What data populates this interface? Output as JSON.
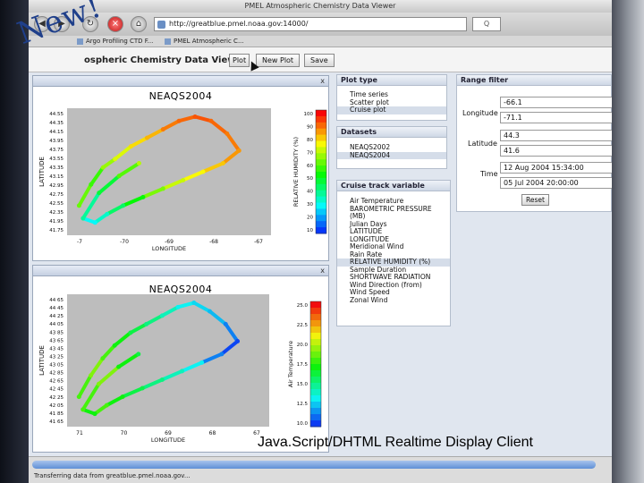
{
  "window": {
    "title": "PMEL Atmospheric Chemistry Data Viewer",
    "url": "http://greatblue.pmel.noaa.gov:14000/",
    "go_label": "Q"
  },
  "tabs": [
    {
      "label": "Argo Profiling CTD F..."
    },
    {
      "label": "PMEL Atmospheric C..."
    }
  ],
  "badge": {
    "text": "New!"
  },
  "app": {
    "title": "ospheric Chemistry Data Viewer",
    "buttons": {
      "plot": "Plot",
      "new_plot": "New Plot",
      "save": "Save"
    }
  },
  "plot_type": {
    "header": "Plot type",
    "items": [
      "Time series",
      "Scatter plot",
      "Cruise plot"
    ],
    "selected": 2
  },
  "datasets": {
    "header": "Datasets",
    "items": [
      "NEAQS2002",
      "NEAQS2004"
    ],
    "selected": 1
  },
  "track_variable": {
    "header": "Cruise track variable",
    "items": [
      "Air Temperature",
      "BAROMETRIC PRESSURE",
      "(MB)",
      "Julian Days",
      "LATITUDE",
      "LONGITUDE",
      "Meridional Wind",
      "Rain Rate",
      "RELATIVE HUMIDITY (%)",
      "Sample Duration",
      "SHORTWAVE RADIATION",
      "Wind Direction (from)",
      "Wind Speed",
      "Zonal Wind"
    ],
    "selected": 8
  },
  "range_filter": {
    "header": "Range filter",
    "longitude_label": "Longitude",
    "longitude_min": "-66.1",
    "longitude_max": "-71.1",
    "latitude_label": "Latitude",
    "latitude_min": "44.3",
    "latitude_max": "41.6",
    "time_label": "Time",
    "time_start": "12 Aug 2004 15:34:00",
    "time_end": "05 Jul 2004 20:00:00",
    "reset_label": "Reset"
  },
  "panels": {
    "close_glyph": "x"
  },
  "status": {
    "text": "Transferring data from greatblue.pmel.noaa.gov..."
  },
  "caption": "Java.Script/DHTML Realtime Display Client",
  "chart_data": [
    {
      "type": "scatter",
      "title": "NEAQS2004",
      "xlabel": "LONGITUDE",
      "ylabel": "LATITUDE",
      "colorbar_label": "RELATIVE HUMIDITY (%)",
      "xticks": [
        "-7",
        "-70",
        "-69",
        "-68",
        "-67"
      ],
      "yticks": [
        "44.55",
        "44.35",
        "44.15",
        "43.95",
        "43.75",
        "43.55",
        "43.35",
        "43.15",
        "42.95",
        "42.75",
        "42.55",
        "42.35",
        "41.95",
        "41.75"
      ],
      "colorbar_ticks": [
        "100",
        "90",
        "80",
        "70",
        "60",
        "50",
        "40",
        "30",
        "20",
        "10"
      ],
      "xlim": [
        -71.2,
        -66.1
      ],
      "ylim": [
        41.6,
        44.6
      ],
      "clim": [
        0,
        100
      ],
      "series": [
        {
          "values": [
            {
              "x": -70.9,
              "y": 42.3,
              "c": 60
            },
            {
              "x": -70.6,
              "y": 42.8,
              "c": 55
            },
            {
              "x": -70.3,
              "y": 43.2,
              "c": 65
            },
            {
              "x": -70.0,
              "y": 43.4,
              "c": 72
            },
            {
              "x": -69.6,
              "y": 43.7,
              "c": 78
            },
            {
              "x": -69.2,
              "y": 43.9,
              "c": 82
            },
            {
              "x": -68.8,
              "y": 44.1,
              "c": 88
            },
            {
              "x": -68.4,
              "y": 44.3,
              "c": 90
            },
            {
              "x": -68.0,
              "y": 44.4,
              "c": 92
            },
            {
              "x": -67.6,
              "y": 44.3,
              "c": 90
            },
            {
              "x": -67.2,
              "y": 44.0,
              "c": 88
            },
            {
              "x": -66.9,
              "y": 43.6,
              "c": 85
            },
            {
              "x": -67.3,
              "y": 43.3,
              "c": 80
            },
            {
              "x": -67.8,
              "y": 43.1,
              "c": 75
            },
            {
              "x": -68.3,
              "y": 42.9,
              "c": 70
            },
            {
              "x": -68.8,
              "y": 42.7,
              "c": 62
            },
            {
              "x": -69.3,
              "y": 42.5,
              "c": 50
            },
            {
              "x": -69.8,
              "y": 42.3,
              "c": 40
            },
            {
              "x": -70.2,
              "y": 42.1,
              "c": 30
            },
            {
              "x": -70.5,
              "y": 41.9,
              "c": 25
            },
            {
              "x": -70.8,
              "y": 42.0,
              "c": 35
            },
            {
              "x": -70.4,
              "y": 42.6,
              "c": 45
            },
            {
              "x": -69.9,
              "y": 43.0,
              "c": 58
            },
            {
              "x": -69.4,
              "y": 43.3,
              "c": 68
            }
          ]
        }
      ]
    },
    {
      "type": "scatter",
      "title": "NEAQS2004",
      "xlabel": "LONGITUDE",
      "ylabel": "LATITUDE",
      "colorbar_label": "Air Temperature",
      "xticks": [
        "71",
        "70",
        "69",
        "68",
        "67"
      ],
      "yticks": [
        "44 65",
        "44 45",
        "44 25",
        "44 05",
        "43 85",
        "43 65",
        "43 45",
        "43 25",
        "43 05",
        "42 85",
        "42 65",
        "42 45",
        "42 25",
        "42 05",
        "41 85",
        "41 65"
      ],
      "colorbar_ticks": [
        "25.0",
        "22.5",
        "20.0",
        "17.5",
        "15.0",
        "12.5",
        "10.0"
      ],
      "xlim": [
        -71.2,
        -66.1
      ],
      "ylim": [
        41.6,
        44.7
      ],
      "clim": [
        10,
        26
      ],
      "series": [
        {
          "values": [
            {
              "x": -70.9,
              "y": 42.3,
              "c": 19
            },
            {
              "x": -70.6,
              "y": 42.8,
              "c": 20
            },
            {
              "x": -70.3,
              "y": 43.2,
              "c": 19
            },
            {
              "x": -70.0,
              "y": 43.5,
              "c": 18
            },
            {
              "x": -69.6,
              "y": 43.8,
              "c": 17
            },
            {
              "x": -69.2,
              "y": 44.0,
              "c": 16
            },
            {
              "x": -68.8,
              "y": 44.2,
              "c": 15
            },
            {
              "x": -68.4,
              "y": 44.4,
              "c": 14
            },
            {
              "x": -68.0,
              "y": 44.5,
              "c": 13.5
            },
            {
              "x": -67.6,
              "y": 44.3,
              "c": 13
            },
            {
              "x": -67.2,
              "y": 44.0,
              "c": 12
            },
            {
              "x": -66.9,
              "y": 43.6,
              "c": 11
            },
            {
              "x": -67.3,
              "y": 43.3,
              "c": 12
            },
            {
              "x": -67.8,
              "y": 43.1,
              "c": 14
            },
            {
              "x": -68.3,
              "y": 42.9,
              "c": 15
            },
            {
              "x": -68.8,
              "y": 42.7,
              "c": 16
            },
            {
              "x": -69.3,
              "y": 42.5,
              "c": 17
            },
            {
              "x": -69.8,
              "y": 42.3,
              "c": 18
            },
            {
              "x": -70.2,
              "y": 42.1,
              "c": 19
            },
            {
              "x": -70.5,
              "y": 41.9,
              "c": 18
            },
            {
              "x": -70.8,
              "y": 42.0,
              "c": 19
            },
            {
              "x": -70.4,
              "y": 42.6,
              "c": 20
            },
            {
              "x": -69.9,
              "y": 43.0,
              "c": 18
            },
            {
              "x": -69.4,
              "y": 43.3,
              "c": 17
            }
          ]
        }
      ]
    }
  ]
}
